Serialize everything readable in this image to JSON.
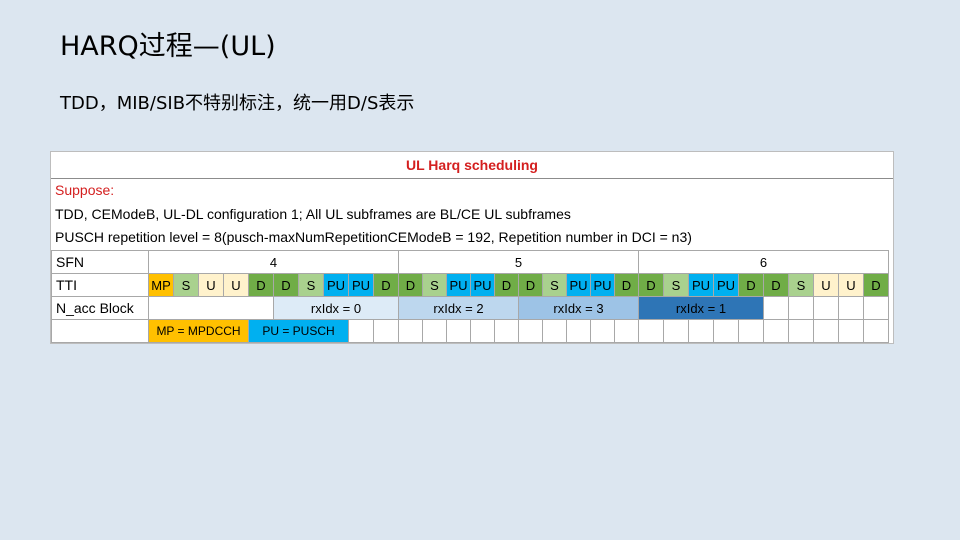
{
  "page": {
    "title": "HARQ过程—(UL)",
    "subtitle": "TDD，MIB/SIB不特别标注，统一用D/S表示"
  },
  "sheet": {
    "title": "UL Harq scheduling",
    "suppose": "Suppose:",
    "line1": "TDD, CEModeB, UL-DL configuration 1;  All UL subframes are BL/CE UL subframes",
    "line2": "PUSCH repetition level = 8(pusch-maxNumRepetitionCEModeB = 192, Repetition number in DCI = n3)",
    "row_labels": {
      "sfn": "SFN",
      "tti": "TTI",
      "nacc": "N_acc Block"
    },
    "sfn_values": [
      "4",
      "5",
      "6"
    ],
    "tti": [
      "MP",
      "S",
      "U",
      "U",
      "D",
      "D",
      "S",
      "PU",
      "PU",
      "D",
      "D",
      "S",
      "PU",
      "PU",
      "D",
      "D",
      "S",
      "PU",
      "PU",
      "D",
      "D",
      "S",
      "PU",
      "PU",
      "D",
      "D",
      "S",
      "U",
      "U",
      "D"
    ],
    "nacc_blocks": [
      "rxIdx = 0",
      "rxIdx = 2",
      "rxIdx = 3",
      "rxIdx = 1"
    ],
    "legend": {
      "mp": "MP = MPDCCH",
      "pu": "PU = PUSCH"
    },
    "colors": {
      "D": "#70ad47",
      "S": "#a9d18e",
      "U": "#fff2cc",
      "PU": "#00b0f0",
      "MP": "#ffc000",
      "rx0": "#ddebf7",
      "rx2": "#bdd7ee",
      "rx3": "#9dc3e6",
      "rx1": "#2e75b6",
      "title_red": "#d41f1f"
    }
  }
}
